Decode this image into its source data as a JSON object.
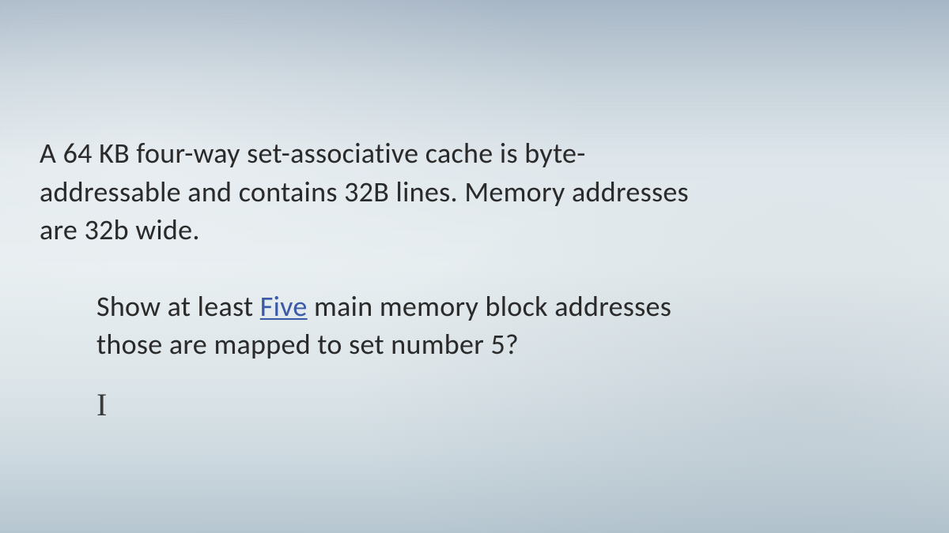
{
  "paragraph1": {
    "line1": "A 64 KB four-way set-associative cache is byte-",
    "line2": "addressable and contains 32B lines. Memory addresses",
    "line3": "are 32b wide."
  },
  "paragraph2": {
    "part1": "Show at least ",
    "underlined": "Five",
    "part2": " main memory block addresses",
    "line2": "those are mapped to set number 5?"
  },
  "cursor": "I"
}
